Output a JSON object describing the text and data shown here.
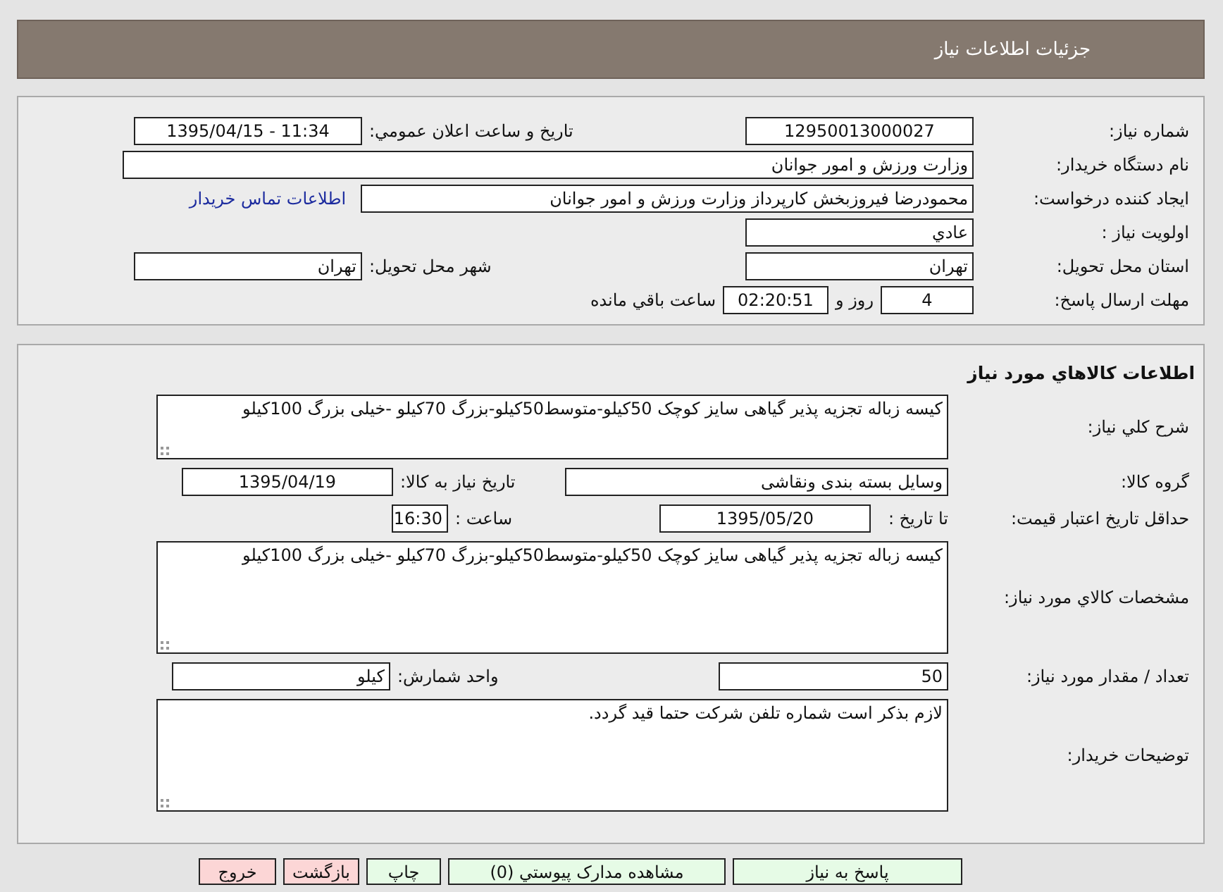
{
  "header": {
    "title": "جزئیات اطلاعات نیاز"
  },
  "need_info": {
    "rows": [
      {
        "items": [
          {
            "kind": "label",
            "text": "شماره نیاز:"
          },
          {
            "kind": "field",
            "value": "12950013000027"
          },
          {
            "kind": "text",
            "text": "تاریخ و ساعت اعلان عمومي:"
          },
          {
            "kind": "field",
            "value": "1395/04/15 - 11:34"
          }
        ]
      },
      {
        "items": [
          {
            "kind": "label",
            "text": "نام دستگاه خریدار:"
          },
          {
            "kind": "field",
            "value": "وزارت ورزش و امور جوانان"
          }
        ]
      },
      {
        "items": [
          {
            "kind": "label",
            "text": "ایجاد کننده درخواست:"
          },
          {
            "kind": "field",
            "value": "محمودرضا فیروزبخش کارپرداز وزارت ورزش و امور جوانان"
          },
          {
            "kind": "link",
            "text": "اطلاعات تماس خریدار"
          }
        ]
      },
      {
        "items": [
          {
            "kind": "label",
            "text": "اولویت نیاز :"
          },
          {
            "kind": "field",
            "value": "عادي"
          }
        ]
      },
      {
        "items": [
          {
            "kind": "label",
            "text": "استان محل تحویل:"
          },
          {
            "kind": "field",
            "value": "تهران"
          },
          {
            "kind": "text",
            "text": "شهر محل تحویل:"
          },
          {
            "kind": "field",
            "value": "تهران"
          }
        ]
      },
      {
        "items": [
          {
            "kind": "label",
            "text": "مهلت ارسال پاسخ:"
          },
          {
            "kind": "field",
            "value": "4"
          },
          {
            "kind": "text",
            "text": "روز و"
          },
          {
            "kind": "field",
            "value": "02:20:51"
          },
          {
            "kind": "text",
            "text": "ساعت باقي مانده"
          }
        ]
      }
    ]
  },
  "goods_info": {
    "title": "اطلاعات کالاهاي مورد نیاز",
    "rows": [
      {
        "items": [
          {
            "kind": "label",
            "text": "شرح کلي نیاز:"
          },
          {
            "kind": "textarea",
            "value": "کیسه زباله تجزیه پذیر گیاهی سایز کوچک 50کیلو-متوسط50کیلو-بزرگ 70کیلو -خیلی بزرگ 100کیلو"
          }
        ]
      },
      {
        "items": [
          {
            "kind": "label",
            "text": "گروه کالا:"
          },
          {
            "kind": "field",
            "value": "وسایل بسته بندی  ونقاشی"
          },
          {
            "kind": "text",
            "text": "تاریخ نیاز به کالا:"
          },
          {
            "kind": "field",
            "value": "1395/04/19"
          }
        ]
      },
      {
        "items": [
          {
            "kind": "label",
            "text": "حداقل تاریخ اعتبار قیمت:"
          },
          {
            "kind": "text",
            "text": "تا تاریخ :"
          },
          {
            "kind": "field",
            "value": "1395/05/20"
          },
          {
            "kind": "text",
            "text": "ساعت :"
          },
          {
            "kind": "field",
            "value": "16:30"
          }
        ]
      },
      {
        "items": [
          {
            "kind": "label",
            "text": "مشخصات کالاي مورد نیاز:"
          },
          {
            "kind": "textarea",
            "value": "کیسه زباله تجزیه پذیر گیاهی سایز کوچک 50کیلو-متوسط50کیلو-بزرگ 70کیلو -خیلی بزرگ 100کیلو"
          }
        ]
      },
      {
        "items": [
          {
            "kind": "label",
            "text": "تعداد / مقدار مورد نیاز:"
          },
          {
            "kind": "field",
            "value": "50"
          },
          {
            "kind": "text",
            "text": "واحد شمارش:"
          },
          {
            "kind": "field",
            "value": "کیلو"
          }
        ]
      },
      {
        "items": [
          {
            "kind": "label",
            "text": "توضیحات خریدار:"
          },
          {
            "kind": "textarea",
            "value": "لازم بذکر است شماره تلفن شرکت حتما قید گردد."
          }
        ]
      }
    ]
  },
  "buttons": [
    {
      "label": "پاسخ به نیاز",
      "kind": "action"
    },
    {
      "label": "مشاهده مدارک پیوستي (0)",
      "kind": "action"
    },
    {
      "label": "چاپ",
      "kind": "action"
    },
    {
      "label": "بازگشت",
      "kind": "cancel"
    },
    {
      "label": "خروج",
      "kind": "cancel"
    }
  ]
}
